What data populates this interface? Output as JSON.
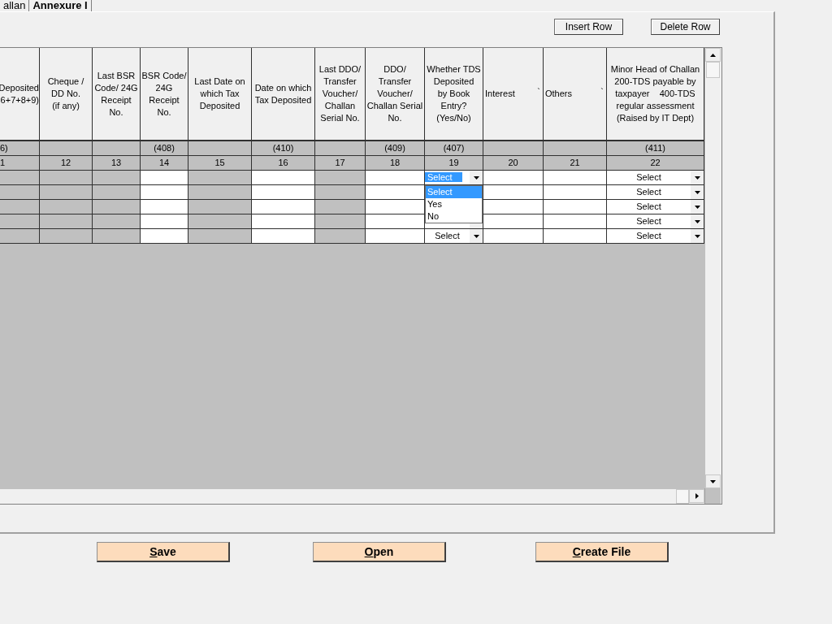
{
  "tabs": [
    {
      "label": "allan",
      "selected": false
    },
    {
      "label": "Annexure I",
      "selected": true
    }
  ],
  "toolbar": {
    "buttons": [
      "Insert Row",
      "Delete Row"
    ]
  },
  "table": {
    "columns": [
      {
        "header": "Deposited\n6+7+8+9)",
        "code": "6)",
        "number": "1",
        "kind": "disabled"
      },
      {
        "header": "Cheque /\nDD No.\n(if any)",
        "number": "12",
        "kind": "disabled"
      },
      {
        "header": "Last BSR\nCode/ 24G\nReceipt\nNo.",
        "number": "13",
        "kind": "disabled"
      },
      {
        "header": "BSR Code/\n24G\nReceipt\nNo.",
        "code": "(408)",
        "number": "14",
        "kind": "input"
      },
      {
        "header": "Last Date on\nwhich Tax\nDeposited",
        "number": "15",
        "kind": "disabled"
      },
      {
        "header": "Date on which\nTax Deposited",
        "code": "(410)",
        "number": "16",
        "kind": "input"
      },
      {
        "header": "Last DDO/\nTransfer\nVoucher/\nChallan\nSerial No.",
        "number": "17",
        "kind": "disabled"
      },
      {
        "header": "DDO/\nTransfer\nVoucher/\nChallan Serial\nNo.",
        "code": "(409)",
        "number": "18",
        "kind": "input"
      },
      {
        "header": "Whether TDS\nDeposited\nby Book\nEntry?\n(Yes/No)",
        "code": "(407)",
        "number": "19",
        "kind": "select"
      },
      {
        "header": "Interest",
        "mark": "`",
        "number": "20",
        "kind": "input"
      },
      {
        "header": "Others",
        "mark": "`",
        "number": "21",
        "kind": "input"
      },
      {
        "header": "Minor Head of Challan\n200-TDS payable by\ntaxpayer    400-TDS\nregular assessment\n(Raised by IT Dept)",
        "code": "(411)",
        "number": "22",
        "kind": "select"
      }
    ],
    "rows": [
      {
        "book_entry": "Select",
        "minor_head": "Select",
        "focused": true
      },
      {
        "minor_head": "Select"
      },
      {
        "minor_head": "Select"
      },
      {
        "book_entry_partly_covered": true,
        "minor_head": "Select"
      },
      {
        "book_entry": "Select",
        "minor_head": "Select"
      }
    ],
    "dropdown": {
      "options": [
        {
          "label": "Select",
          "selected": true
        },
        {
          "label": "Yes",
          "selected": false
        },
        {
          "label": "No",
          "selected": false
        }
      ]
    }
  },
  "actions": [
    "Save",
    "Open",
    "Create File"
  ]
}
